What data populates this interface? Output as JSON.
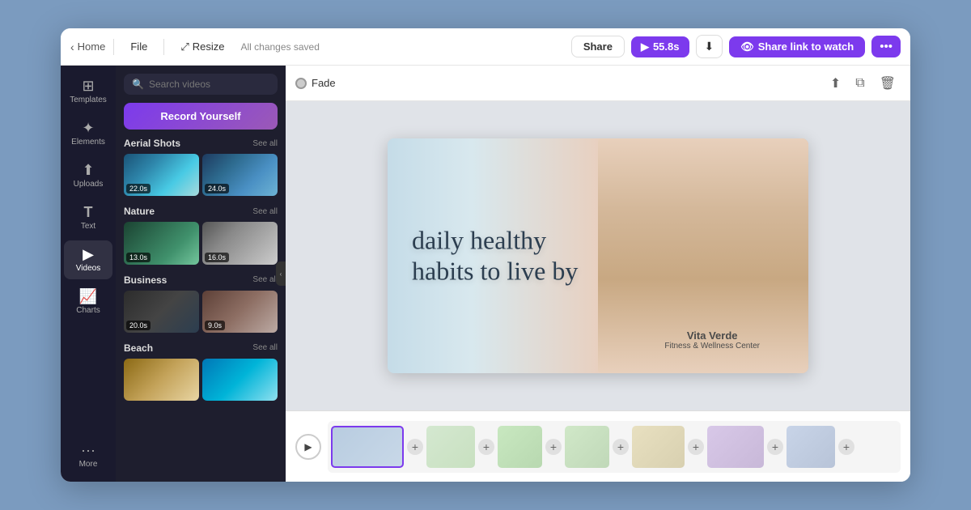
{
  "topbar": {
    "back_label": "Home",
    "file_label": "File",
    "resize_label": "Resize",
    "saved_label": "All changes saved",
    "share_label": "Share",
    "play_duration": "55.8s",
    "watch_label": "Share link to watch",
    "more_label": "..."
  },
  "sidebar": {
    "items": [
      {
        "id": "templates",
        "label": "Templates",
        "icon": "⊞"
      },
      {
        "id": "elements",
        "label": "Elements",
        "icon": "✦"
      },
      {
        "id": "uploads",
        "label": "Uploads",
        "icon": "⬆"
      },
      {
        "id": "text",
        "label": "Text",
        "icon": "T"
      },
      {
        "id": "videos",
        "label": "Videos",
        "icon": "▶"
      },
      {
        "id": "charts",
        "label": "Charts",
        "icon": "📈"
      },
      {
        "id": "more",
        "label": "More",
        "icon": "···"
      }
    ]
  },
  "videos_panel": {
    "search_placeholder": "Search videos",
    "record_label": "Record Yourself",
    "categories": [
      {
        "title": "Aerial Shots",
        "see_all": "See all",
        "clips": [
          {
            "duration": "22.0s",
            "style": "thumb-aerial1"
          },
          {
            "duration": "24.0s",
            "style": "thumb-aerial2"
          }
        ]
      },
      {
        "title": "Nature",
        "see_all": "See all",
        "clips": [
          {
            "duration": "13.0s",
            "style": "thumb-nature1"
          },
          {
            "duration": "16.0s",
            "style": "thumb-nature2"
          }
        ]
      },
      {
        "title": "Business",
        "see_all": "See all",
        "clips": [
          {
            "duration": "20.0s",
            "style": "thumb-biz1"
          },
          {
            "duration": "9.0s",
            "style": "thumb-biz2"
          }
        ]
      },
      {
        "title": "Beach",
        "see_all": "See all",
        "clips": [
          {
            "duration": "",
            "style": "thumb-beach1"
          },
          {
            "duration": "",
            "style": "thumb-beach2"
          }
        ]
      }
    ]
  },
  "canvas": {
    "transition_label": "Fade",
    "slide": {
      "main_text": "daily healthy\nhabits to live by",
      "brand_name": "Vita Verde",
      "brand_sub": "Fitness & Wellness Center"
    }
  },
  "timeline": {
    "play_icon": "▶"
  }
}
